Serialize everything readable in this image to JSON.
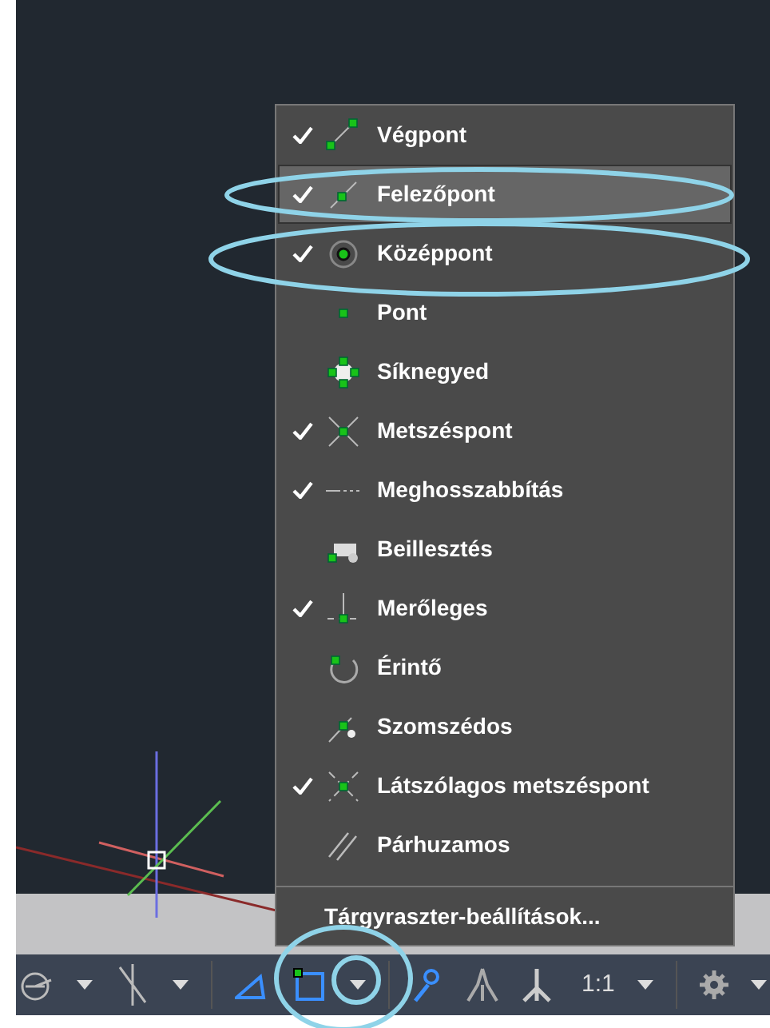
{
  "menu": {
    "items": [
      {
        "label": "Végpont",
        "kind": "endpoint",
        "checked": true,
        "selected": false
      },
      {
        "label": "Felezőpont",
        "kind": "midpoint",
        "checked": true,
        "selected": true
      },
      {
        "label": "Középpont",
        "kind": "center",
        "checked": true,
        "selected": false
      },
      {
        "label": "Pont",
        "kind": "node",
        "checked": false,
        "selected": false
      },
      {
        "label": "Síknegyed",
        "kind": "quadrant",
        "checked": false,
        "selected": false
      },
      {
        "label": "Metszéspont",
        "kind": "intersection",
        "checked": true,
        "selected": false
      },
      {
        "label": "Meghosszabbítás",
        "kind": "extension",
        "checked": true,
        "selected": false
      },
      {
        "label": "Beillesztés",
        "kind": "insertion",
        "checked": false,
        "selected": false
      },
      {
        "label": "Merőleges",
        "kind": "perpendicular",
        "checked": true,
        "selected": false
      },
      {
        "label": "Érintő",
        "kind": "tangent",
        "checked": false,
        "selected": false
      },
      {
        "label": "Szomszédos",
        "kind": "nearest",
        "checked": false,
        "selected": false
      },
      {
        "label": "Látszólagos metszéspont",
        "kind": "apparent",
        "checked": true,
        "selected": false
      },
      {
        "label": "Párhuzamos",
        "kind": "parallel",
        "checked": false,
        "selected": false
      }
    ],
    "footer": "Tárgyraszter-beállítások..."
  },
  "status_bar": {
    "scale": "1:1"
  }
}
